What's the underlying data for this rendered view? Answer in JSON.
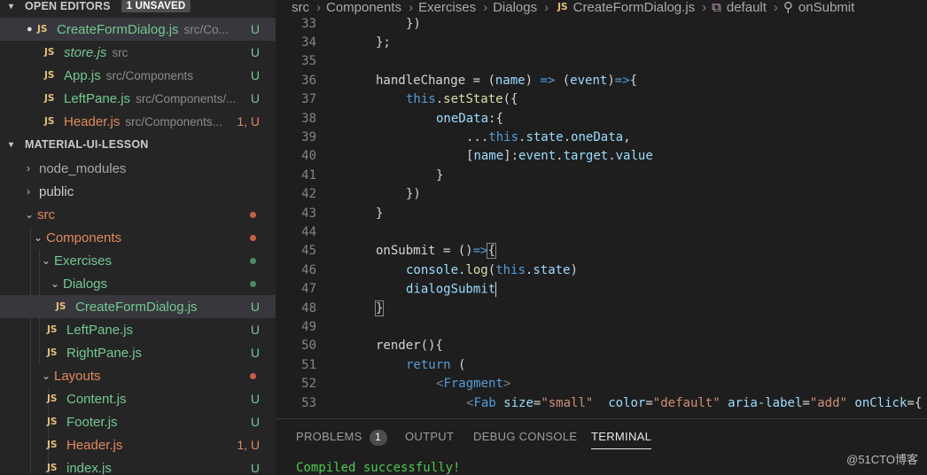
{
  "sidebar": {
    "open_editors": {
      "title": "OPEN EDITORS",
      "badge": "1 UNSAVED"
    },
    "open_files": [
      {
        "name": "CreateFormDialog.js",
        "path": "src/Co...",
        "status": "U",
        "dirty": true
      },
      {
        "name": "store.js",
        "path": "src",
        "status": "U"
      },
      {
        "name": "App.js",
        "path": "src/Components",
        "status": "U"
      },
      {
        "name": "LeftPane.js",
        "path": "src/Components/...",
        "status": "U"
      },
      {
        "name": "Header.js",
        "path": "src/Components...",
        "status": "1, U"
      }
    ],
    "project": {
      "title": "MATERIAL-UI-LESSON"
    },
    "tree": [
      {
        "label": "node_modules"
      },
      {
        "label": "public"
      },
      {
        "label": "src"
      },
      {
        "label": "Components"
      },
      {
        "label": "Exercises"
      },
      {
        "label": "Dialogs"
      },
      {
        "label": "CreateFormDialog.js",
        "status": "U"
      },
      {
        "label": "LeftPane.js",
        "status": "U"
      },
      {
        "label": "RightPane.js",
        "status": "U"
      },
      {
        "label": "Layouts"
      },
      {
        "label": "Content.js",
        "status": "U"
      },
      {
        "label": "Footer.js",
        "status": "U"
      },
      {
        "label": "Header.js",
        "status": "1, U"
      },
      {
        "label": "index.js",
        "status": "U"
      }
    ],
    "js_icon": "JS"
  },
  "breadcrumb": {
    "items": [
      "src",
      "Components",
      "Exercises",
      "Dialogs",
      "CreateFormDialog.js",
      "default",
      "onSubmit"
    ]
  },
  "editor": {
    "line_numbers": [
      "33",
      "34",
      "35",
      "36",
      "37",
      "38",
      "39",
      "40",
      "41",
      "42",
      "43",
      "44",
      "45",
      "46",
      "47",
      "48",
      "49",
      "50",
      "51",
      "52",
      "53"
    ],
    "l33": "})",
    "l34": "};",
    "l36_a": "handleChange",
    "l36_b": " = (",
    "l36_c": "name",
    "l36_d": ") ",
    "l36_e": "=>",
    "l36_f": " (",
    "l36_g": "event",
    "l36_h": ")",
    "l36_i": "=>",
    "l36_j": "{",
    "l37_a": "this",
    "l37_b": ".",
    "l37_c": "setState",
    "l37_d": "({",
    "l38_a": "oneData",
    "l38_b": ":{",
    "l39_a": "...",
    "l39_b": "this",
    "l39_c": ".",
    "l39_d": "state",
    "l39_e": ".",
    "l39_f": "oneData",
    "l39_g": ",",
    "l40_a": "[",
    "l40_b": "name",
    "l40_c": "]:",
    "l40_d": "event",
    "l40_e": ".",
    "l40_f": "target",
    "l40_g": ".",
    "l40_h": "value",
    "l41": "}",
    "l42": "})",
    "l43": "}",
    "l45_a": "onSubmit",
    "l45_b": " = ()",
    "l45_c": "=>",
    "l45_d": "{",
    "l46_a": "console",
    "l46_b": ".",
    "l46_c": "log",
    "l46_d": "(",
    "l46_e": "this",
    "l46_f": ".",
    "l46_g": "state",
    "l46_h": ")",
    "l47": "dialogSubmit",
    "l48": "}",
    "l50_a": "render",
    "l50_b": "(){",
    "l51_a": "return",
    "l51_b": " (",
    "l52_a": "<",
    "l52_b": "Fragment",
    "l52_c": ">",
    "l53_a": "<",
    "l53_b": "Fab",
    "l53_c": " size",
    "l53_d": "=",
    "l53_e": "\"small\"",
    "l53_f": "  color",
    "l53_g": "=",
    "l53_h": "\"default\"",
    "l53_i": " aria-label",
    "l53_j": "=",
    "l53_k": "\"add\"",
    "l53_l": " onClick",
    "l53_m": "={"
  },
  "panel": {
    "tabs": [
      "PROBLEMS",
      "OUTPUT",
      "DEBUG CONSOLE",
      "TERMINAL"
    ],
    "problems_count": "1",
    "terminal_output": "Compiled successfully!"
  },
  "watermark": "@51CTO博客",
  "colors": {
    "untracked": "#73c991",
    "modified": "#e2895c",
    "keyword": "#569cd6",
    "function": "#dcdcaa",
    "variable": "#9cdcfe",
    "string": "#ce9178"
  }
}
